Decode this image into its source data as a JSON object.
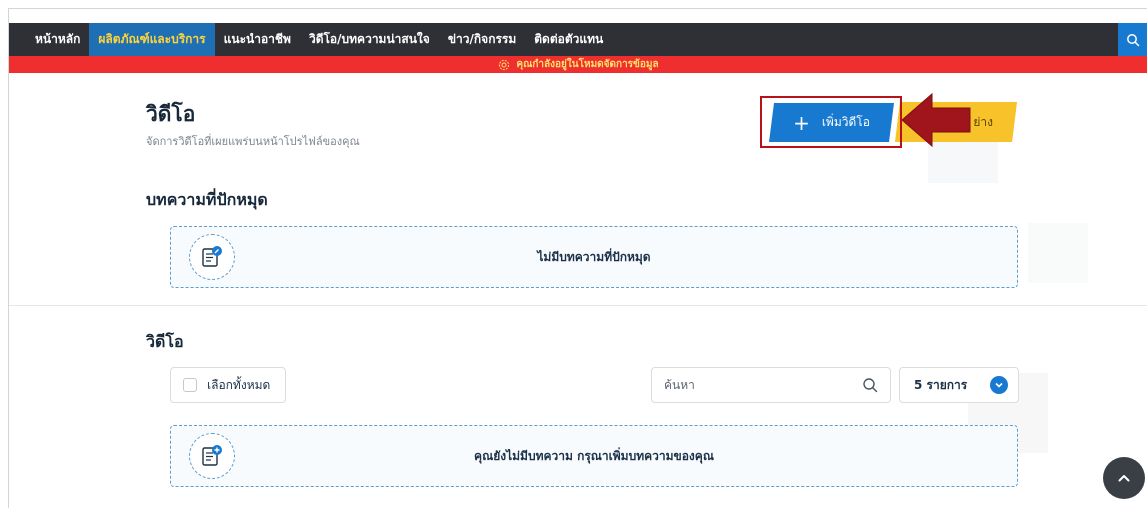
{
  "nav": {
    "items": [
      {
        "label": "หน้าหลัก"
      },
      {
        "label": "ผลิตภัณฑ์และบริการ"
      },
      {
        "label": "แนะนำอาชีพ"
      },
      {
        "label": "วิดีโอ/บทความน่าสนใจ"
      },
      {
        "label": "ข่าว/กิจกรรม"
      },
      {
        "label": "ติดต่อตัวแทน"
      }
    ],
    "active_index": 1,
    "search_icon": "search-icon"
  },
  "alert": {
    "text": "คุณกำลังอยู่ในโหมดจัดการข้อมูล",
    "icon": "gear-icon"
  },
  "header": {
    "title": "วิดีโอ",
    "subtitle": "จัดการวิดีโอที่เผยแพร่บนหน้าโปรไฟล์ของคุณ",
    "add_button": {
      "label": "เพิ่มวิดีโอ",
      "icon": "plus-icon"
    },
    "example_button_label": "ย่าง"
  },
  "pinned": {
    "title": "บทความที่ปักหมุด",
    "empty_text": "ไม่มีบทความที่ปักหมุด"
  },
  "videos": {
    "title": "วิดีโอ",
    "select_all_label": "เลือกทั้งหมด",
    "search_placeholder": "ค้นหา",
    "per_page_label": "5 รายการ",
    "empty_text": "คุณยังไม่มีบทความ กรุณาเพิ่มบทความของคุณ"
  },
  "colors": {
    "nav_bg": "#2f2f36",
    "nav_active_bg": "#1f6fb5",
    "accent_blue": "#1779d0",
    "alert_red": "#ef2f2f",
    "alert_text": "#ffe26a",
    "highlight_red": "#b5121b",
    "yellow_button": "#f7c22a"
  }
}
